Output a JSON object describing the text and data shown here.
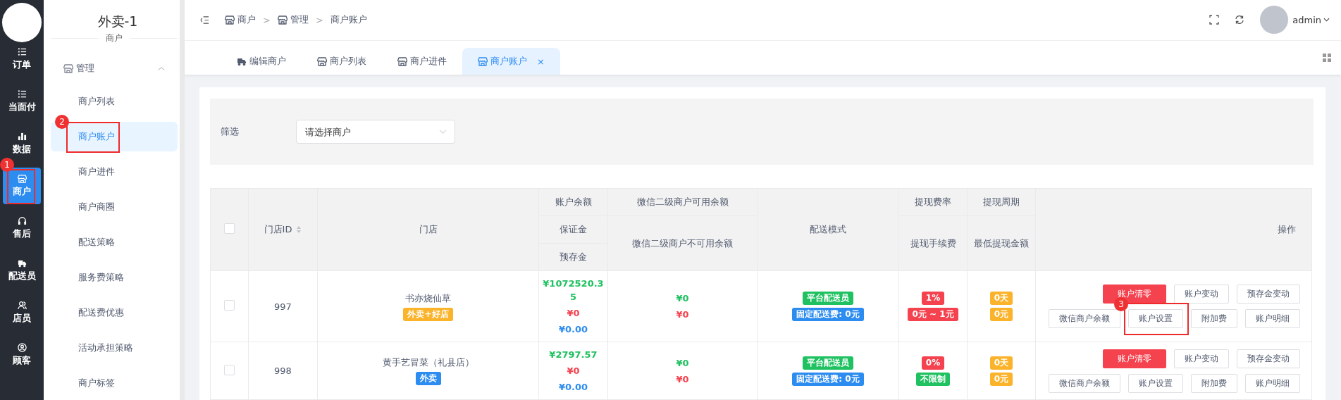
{
  "nav_rail": {
    "items": [
      {
        "label": "订单",
        "selected": false
      },
      {
        "label": "当面付",
        "selected": false
      },
      {
        "label": "数据",
        "selected": false
      },
      {
        "label": "商户",
        "selected": true,
        "callout": "1"
      },
      {
        "label": "售后",
        "selected": false
      },
      {
        "label": "配送员",
        "selected": false
      },
      {
        "label": "店员",
        "selected": false
      },
      {
        "label": "顾客",
        "selected": false
      }
    ]
  },
  "sub_sidebar": {
    "title": "外卖-1",
    "subtitle": "商户",
    "group": {
      "label": "管理",
      "expanded": true,
      "items": [
        {
          "label": "商户列表",
          "selected": false
        },
        {
          "label": "商户账户",
          "selected": true,
          "callout": "2"
        },
        {
          "label": "商户进件",
          "selected": false
        },
        {
          "label": "商户商圈",
          "selected": false
        },
        {
          "label": "配送策略",
          "selected": false
        },
        {
          "label": "服务费策略",
          "selected": false
        },
        {
          "label": "配送费优惠",
          "selected": false
        },
        {
          "label": "活动承担策略",
          "selected": false
        },
        {
          "label": "商户标签",
          "selected": false
        }
      ]
    }
  },
  "header": {
    "breadcrumb": [
      "商户",
      "管理",
      "商户账户"
    ],
    "separator": ">",
    "user": "admin"
  },
  "tabs": [
    {
      "label": "编辑商户",
      "selected": false,
      "closable": false
    },
    {
      "label": "商户列表",
      "selected": false,
      "closable": false
    },
    {
      "label": "商户进件",
      "selected": false,
      "closable": false
    },
    {
      "label": "商户账户",
      "selected": true,
      "closable": true,
      "close": "×"
    }
  ],
  "filter": {
    "label": "筛选",
    "placeholder": "请选择商户"
  },
  "table": {
    "header": {
      "checked": false,
      "id": "门店ID",
      "store": "门店",
      "balance": [
        "账户余额",
        "保证金",
        "预存金"
      ],
      "wechat": [
        "微信二级商户可用余额",
        "微信二级商户不可用余额"
      ],
      "delivery": "配送模式",
      "fee": [
        "提现费率",
        "提现手续费"
      ],
      "period": [
        "提现周期",
        "最低提现金额"
      ],
      "actions": "操作"
    },
    "rows": [
      {
        "checked": false,
        "id": "997",
        "store": "书亦烧仙草",
        "tag": {
          "text": "外卖+好店",
          "color": "#fbb32b"
        },
        "balance": [
          {
            "text": "¥1072520.35",
            "color": "#1fc160"
          },
          {
            "text": "¥0",
            "color": "#f5424f"
          },
          {
            "text": "¥0.00",
            "color": "#2d8cf0"
          }
        ],
        "wechat": [
          {
            "text": "¥0",
            "color": "#1fc160"
          },
          {
            "text": "¥0",
            "color": "#f5424f"
          }
        ],
        "delivery": [
          {
            "text": "平台配送员",
            "color": "#1fc160"
          },
          {
            "text": "固定配送费: 0元",
            "color": "#2d8cf0"
          }
        ],
        "fee": [
          {
            "text": "1%",
            "color": "#f5424f"
          },
          {
            "text": "0元 ~ 1元",
            "color": "#f5424f"
          }
        ],
        "period": [
          {
            "text": "0天",
            "color": "#fbb32b"
          },
          {
            "text": "0元",
            "color": "#fbb32b"
          }
        ],
        "actions": [
          [
            {
              "label": "账户清零",
              "kind": "danger"
            },
            {
              "label": "账户变动",
              "kind": "default"
            },
            {
              "label": "预存金变动",
              "kind": "default"
            }
          ],
          [
            {
              "label": "微信商户余额",
              "kind": "default"
            },
            {
              "label": "账户设置",
              "kind": "default",
              "callout": "3"
            },
            {
              "label": "附加费",
              "kind": "default"
            },
            {
              "label": "账户明细",
              "kind": "default"
            }
          ]
        ]
      },
      {
        "checked": false,
        "id": "998",
        "store": "黄手艺冒菜（礼县店）",
        "tag": {
          "text": "外卖",
          "color": "#2d8cf0"
        },
        "balance": [
          {
            "text": "¥2797.57",
            "color": "#1fc160"
          },
          {
            "text": "¥0",
            "color": "#f5424f"
          },
          {
            "text": "¥0.00",
            "color": "#2d8cf0"
          }
        ],
        "wechat": [
          {
            "text": "¥0",
            "color": "#1fc160"
          },
          {
            "text": "¥0",
            "color": "#f5424f"
          }
        ],
        "delivery": [
          {
            "text": "平台配送员",
            "color": "#1fc160"
          },
          {
            "text": "固定配送费: 0元",
            "color": "#2d8cf0"
          }
        ],
        "fee": [
          {
            "text": "0%",
            "color": "#f5424f"
          },
          {
            "text": "不限制",
            "color": "#1fc160"
          }
        ],
        "period": [
          {
            "text": "0天",
            "color": "#fbb32b"
          },
          {
            "text": "0元",
            "color": "#fbb32b"
          }
        ],
        "actions": [
          [
            {
              "label": "账户清零",
              "kind": "danger"
            },
            {
              "label": "账户变动",
              "kind": "default"
            },
            {
              "label": "预存金变动",
              "kind": "default"
            }
          ],
          [
            {
              "label": "微信商户余额",
              "kind": "default"
            },
            {
              "label": "账户设置",
              "kind": "default"
            },
            {
              "label": "附加费",
              "kind": "default"
            },
            {
              "label": "账户明细",
              "kind": "default"
            }
          ]
        ]
      }
    ]
  }
}
